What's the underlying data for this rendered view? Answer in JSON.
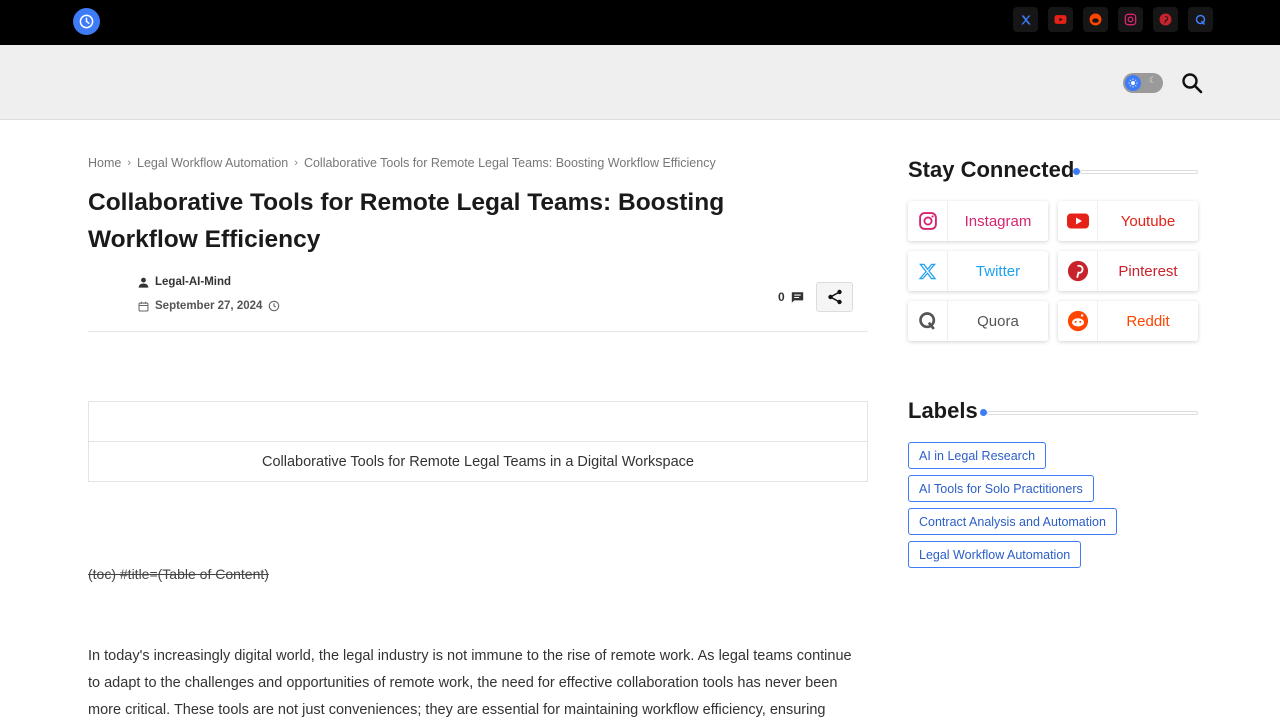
{
  "topbar": {
    "logo_icon": "clock-icon",
    "social_icons": [
      "x-icon",
      "youtube-icon",
      "reddit-icon",
      "instagram-icon",
      "pinterest-icon",
      "quora-icon"
    ]
  },
  "header": {
    "theme_toggle_icon": "sun-icon",
    "search_icon": "search-icon"
  },
  "breadcrumb": {
    "home": "Home",
    "category": "Legal Workflow Automation",
    "current": "Collaborative Tools for Remote Legal Teams: Boosting Workflow Efficiency"
  },
  "post": {
    "title": "Collaborative Tools for Remote Legal Teams: Boosting Workflow Efficiency",
    "author": "Legal-AI-Mind",
    "date": "September 27, 2024",
    "comment_count": "0",
    "image_caption": "Collaborative Tools for Remote Legal Teams in a Digital Workspace",
    "toc_text": "(toc) #title=(Table of Content)",
    "intro": "In today's increasingly digital world, the legal industry is not immune to the rise of remote work. As legal teams continue to adapt to the challenges and opportunities of remote work, the need for effective collaboration tools has never been more critical. These tools are not just conveniences; they are essential for maintaining workflow efficiency, ensuring"
  },
  "sidebar": {
    "stay_connected_title": "Stay Connected",
    "social_links": [
      {
        "label": "Instagram",
        "icon": "instagram-icon",
        "color": "#d6246e"
      },
      {
        "label": "Youtube",
        "icon": "youtube-icon",
        "color": "#e62117"
      },
      {
        "label": "Twitter",
        "icon": "twitter-icon",
        "color": "#1da1f2"
      },
      {
        "label": "Pinterest",
        "icon": "pinterest-icon",
        "color": "#c8232c"
      },
      {
        "label": "Quora",
        "icon": "quora-icon",
        "color": "#555555"
      },
      {
        "label": "Reddit",
        "icon": "reddit-icon",
        "color": "#ff4500"
      }
    ],
    "labels_title": "Labels",
    "labels": [
      "AI in Legal Research",
      "AI Tools for Solo Practitioners",
      "Contract Analysis and Automation",
      "Legal Workflow Automation"
    ]
  },
  "colors": {
    "accent": "#3d7bf7",
    "topbar_bg": "#000000",
    "header_bg": "#efefef"
  }
}
